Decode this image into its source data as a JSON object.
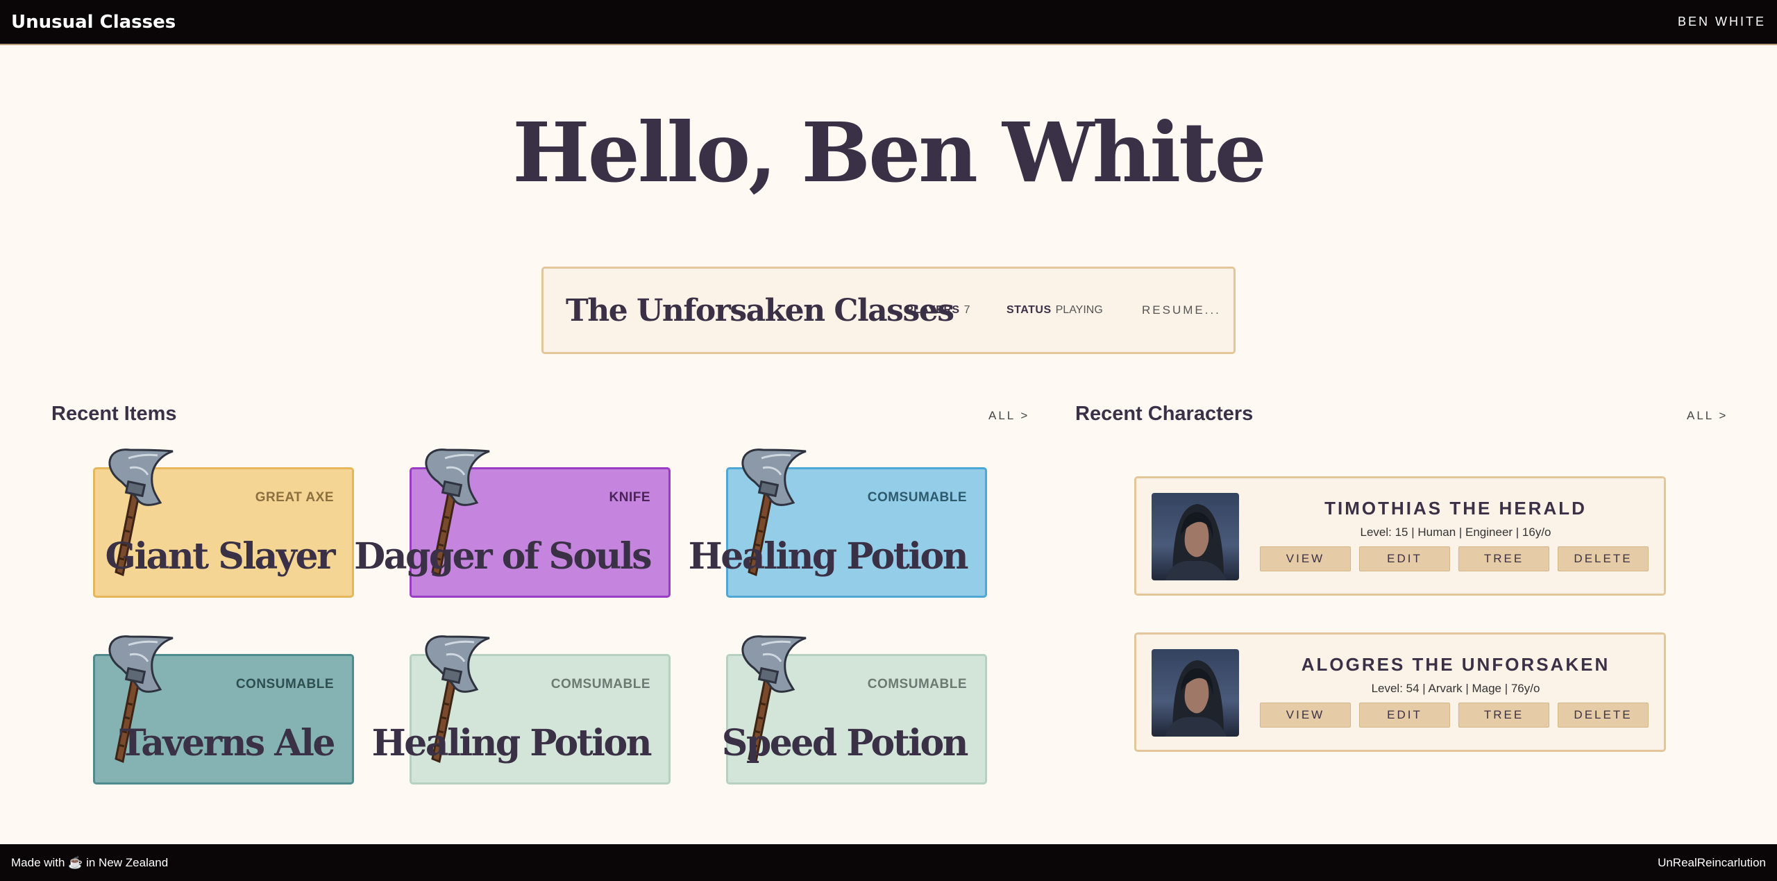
{
  "header": {
    "app_title": "Unusual Classes",
    "user_name": "BEN WHITE"
  },
  "greeting": "Hello, Ben White",
  "campaign": {
    "title": "The Unforsaken Classes",
    "players_label": "PLAYERS",
    "players_value": "7",
    "status_label": "STATUS",
    "status_value": "PLAYING",
    "resume_label": "RESUME..."
  },
  "recent_items": {
    "title": "Recent Items",
    "all_label": "ALL >",
    "items": [
      {
        "type": "GREAT AXE",
        "name": "Giant Slayer",
        "bg": "#f5d593",
        "border": "#e8b65a",
        "type_color": "#8b6f3e",
        "icon": "axe-icon"
      },
      {
        "type": "KNIFE",
        "name": "Dagger of Souls",
        "bg": "#c585de",
        "border": "#9b3dc4",
        "type_color": "#4a2358",
        "icon": "axe-icon"
      },
      {
        "type": "COMSUMABLE",
        "name": "Healing Potion",
        "bg": "#93cde8",
        "border": "#4ea7d4",
        "type_color": "#2d5a6c",
        "icon": "axe-icon"
      },
      {
        "type": "CONSUMABLE",
        "name": "Taverns Ale",
        "bg": "#85b3b3",
        "border": "#4f8a8c",
        "type_color": "#2e4e4f",
        "icon": "axe-icon"
      },
      {
        "type": "COMSUMABLE",
        "name": "Healing Potion",
        "bg": "#d3e4d9",
        "border": "#b7d1c1",
        "type_color": "#6b7b70",
        "icon": "axe-icon"
      },
      {
        "type": "COMSUMABLE",
        "name": "Speed Potion",
        "bg": "#d3e4d9",
        "border": "#b7d1c1",
        "type_color": "#6b7b70",
        "icon": "axe-icon"
      }
    ]
  },
  "recent_characters": {
    "title": "Recent Characters",
    "all_label": "ALL >",
    "characters": [
      {
        "name": "TIMOTHIAS THE HERALD",
        "stats": "Level: 15 | Human | Engineer | 16y/o",
        "actions": [
          "VIEW",
          "EDIT",
          "TREE",
          "DELETE"
        ]
      },
      {
        "name": "ALOGRES THE UNFORSAKEN",
        "stats": "Level: 54 | Arvark | Mage | 76y/o",
        "actions": [
          "VIEW",
          "EDIT",
          "TREE",
          "DELETE"
        ]
      }
    ]
  },
  "footer": {
    "made_with": "Made with ☕ in New Zealand",
    "brand": "UnRealReincarlution"
  }
}
